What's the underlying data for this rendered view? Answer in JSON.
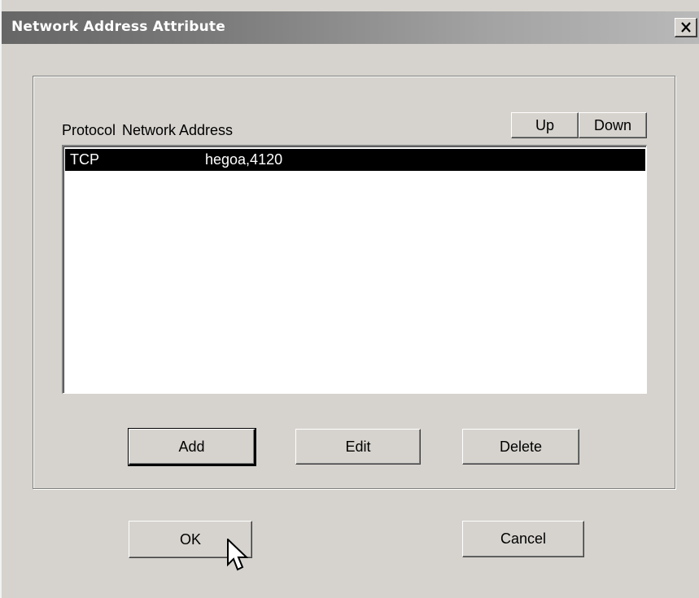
{
  "window": {
    "title": "Network Address Attribute",
    "close_glyph": "✕"
  },
  "list": {
    "columns": [
      "Protocol",
      "Network Address"
    ],
    "rows": [
      {
        "protocol": "TCP",
        "address": "hegoa,4120",
        "selected": true
      }
    ]
  },
  "order_buttons": {
    "up": "Up",
    "down": "Down"
  },
  "list_actions": {
    "add": "Add",
    "edit": "Edit",
    "delete": "Delete"
  },
  "dialog_buttons": {
    "ok": "OK",
    "cancel": "Cancel"
  },
  "colors": {
    "face": "#d6d3ce",
    "selection": "#000000",
    "title_gradient_start": "#666666",
    "title_gradient_end": "#b9b9b9"
  }
}
